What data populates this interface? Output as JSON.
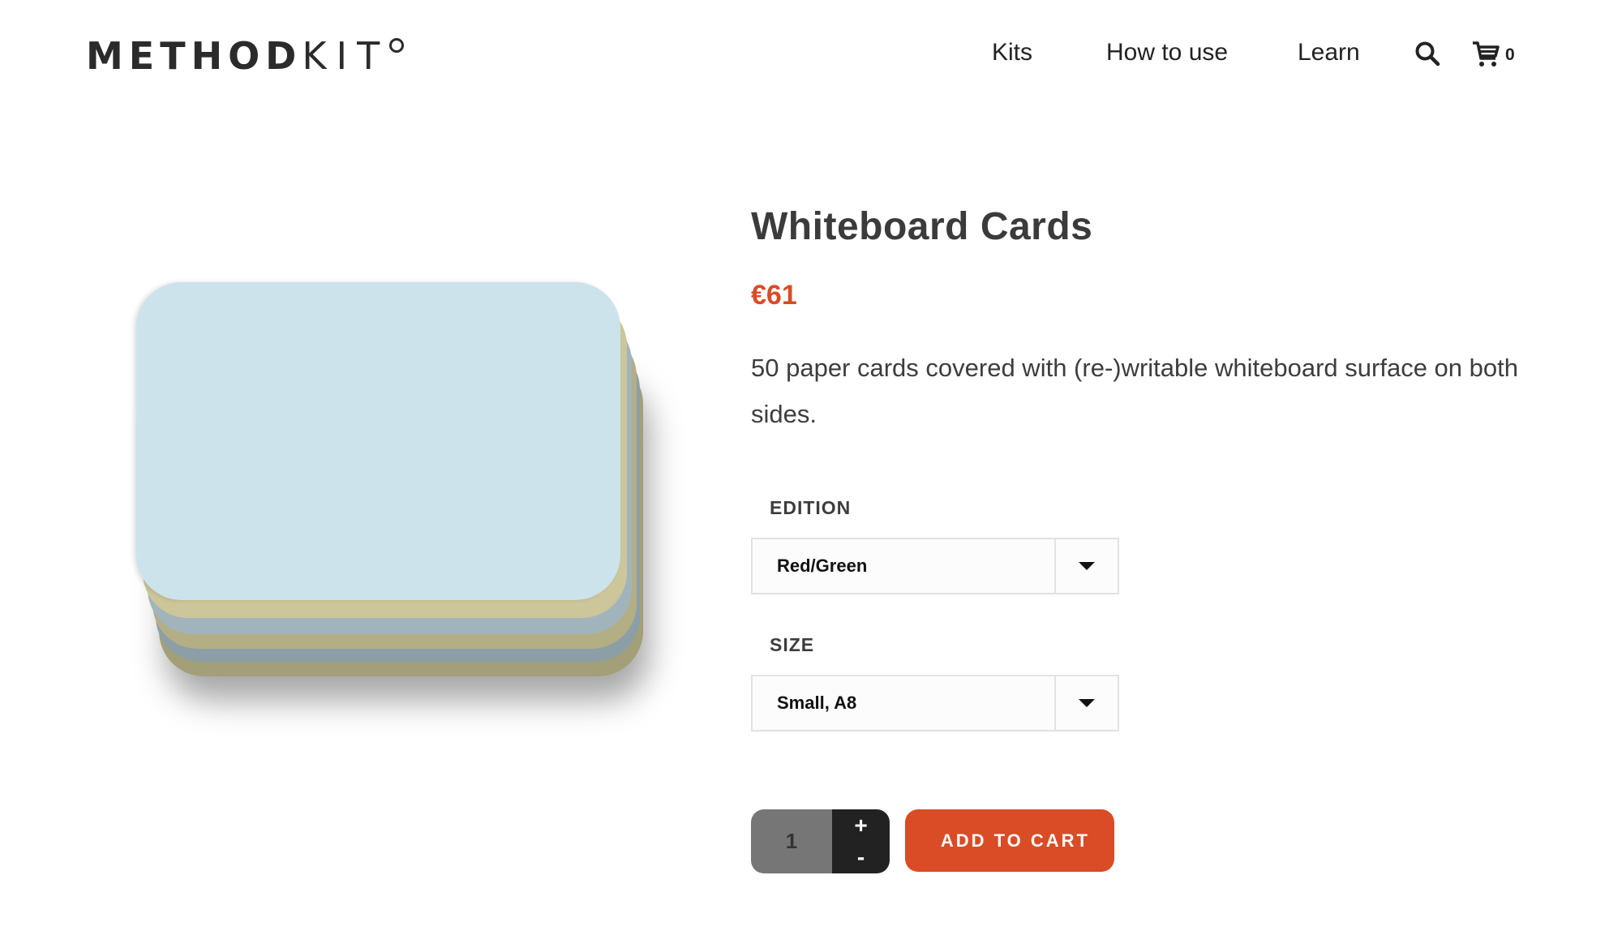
{
  "header": {
    "logo": {
      "bold": "METHOD",
      "light": "KIT",
      "mark": "R"
    },
    "nav": [
      {
        "label": "Kits"
      },
      {
        "label": "How to use"
      },
      {
        "label": "Learn"
      }
    ],
    "search_icon": "search-icon",
    "cart_icon": "cart-icon",
    "cart_count": "0"
  },
  "product": {
    "title": "Whiteboard Cards",
    "price": "€61",
    "description": "50 paper cards covered with (re-)writable whiteboard surface on both sides.",
    "image_alt": "stack of colored whiteboard cards",
    "colors": {
      "accent": "#d94c26",
      "card_top": "#cce3eb",
      "card_yellow": "#cdc69a",
      "card_blue": "#a2b4bb"
    },
    "options": [
      {
        "label": "EDITION",
        "selected": "Red/Green"
      },
      {
        "label": "SIZE",
        "selected": "Small, A8"
      }
    ],
    "quantity": "1",
    "increment_label": "+",
    "decrement_label": "-",
    "add_to_cart_label": "ADD TO CART"
  }
}
